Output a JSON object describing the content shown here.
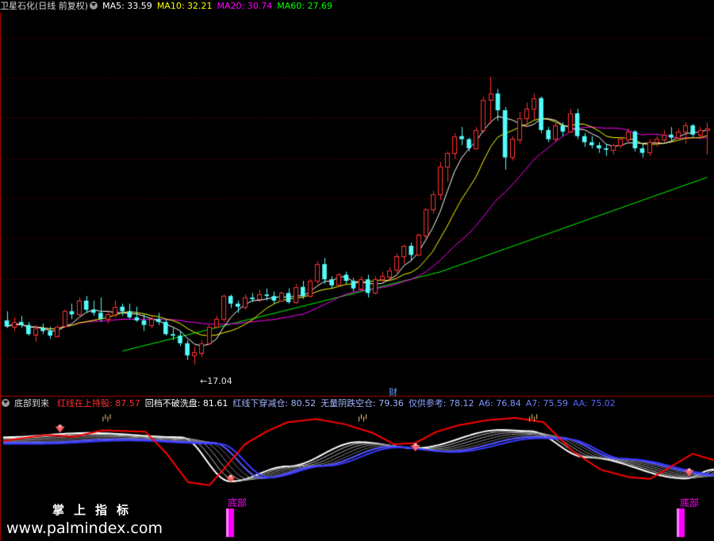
{
  "main_header": {
    "stock": "卫星石化(日线 前复权)",
    "ma5": "MA5: 33.59",
    "ma10": "MA10: 32.21",
    "ma20": "MA20: 30.74",
    "ma60": "MA60: 27.69"
  },
  "sub_header": {
    "name": "底部到来",
    "v1": "红线在上持股: 87.57",
    "v2": "回档不破洗盘: 81.61",
    "v3": "红线下穿减仓: 80.52",
    "v4": "无量阴跌空仓: 79.36",
    "v5": "仅供参考: 78.12",
    "a6": "A6: 76.84",
    "a7": "A7: 75.59",
    "aa": "AA: 75.02"
  },
  "annotations": {
    "low_price": "17.04",
    "cai": "财",
    "bottom1": "底部",
    "bottom2": "底部"
  },
  "watermark": {
    "title": "掌上指标",
    "url": "www.palmindex.com"
  },
  "colors": {
    "up": "#ff3232",
    "down": "#54fcfc",
    "ma5": "#ffffff",
    "ma10": "#ffff00",
    "ma20": "#ff00ff",
    "ma60": "#00ff00",
    "red_line": "#ff0000",
    "blue_line": "#3a3aff",
    "white_line": "#ffffff",
    "bottom_label": "#ff00ff",
    "axis": "#b00000"
  },
  "chart_data": [
    {
      "type": "candlestick",
      "title": "卫星石化(日线 前复权)",
      "ylim": [
        15.0,
        40.0
      ],
      "candles": [
        [
          19.9,
          20.5,
          19.4,
          19.5
        ],
        [
          19.5,
          20.1,
          19.2,
          19.8
        ],
        [
          19.8,
          20.2,
          19.4,
          19.6
        ],
        [
          19.6,
          19.8,
          18.9,
          19.0
        ],
        [
          19.0,
          19.6,
          18.5,
          19.4
        ],
        [
          19.4,
          19.7,
          19.0,
          19.2
        ],
        [
          19.2,
          19.5,
          18.7,
          18.9
        ],
        [
          18.9,
          19.6,
          18.8,
          19.5
        ],
        [
          19.5,
          20.6,
          19.4,
          20.5
        ],
        [
          20.5,
          21.0,
          20.0,
          20.3
        ],
        [
          20.3,
          21.4,
          20.1,
          21.2
        ],
        [
          21.2,
          21.5,
          20.4,
          20.6
        ],
        [
          20.6,
          21.2,
          20.2,
          20.4
        ],
        [
          20.4,
          21.4,
          19.8,
          20.0
        ],
        [
          20.0,
          20.5,
          19.7,
          20.3
        ],
        [
          20.3,
          21.2,
          20.1,
          20.8
        ],
        [
          20.8,
          21.0,
          20.2,
          20.5
        ],
        [
          20.5,
          21.0,
          20.0,
          20.1
        ],
        [
          20.1,
          20.8,
          19.8,
          19.9
        ],
        [
          19.9,
          20.3,
          19.2,
          19.6
        ],
        [
          19.6,
          20.2,
          19.4,
          20.0
        ],
        [
          20.0,
          20.4,
          19.6,
          19.8
        ],
        [
          19.8,
          20.0,
          18.9,
          19.0
        ],
        [
          19.0,
          19.4,
          18.6,
          18.9
        ],
        [
          18.9,
          19.2,
          18.2,
          18.4
        ],
        [
          18.4,
          18.6,
          17.3,
          17.6
        ],
        [
          17.6,
          18.2,
          17.0,
          17.8
        ],
        [
          17.8,
          18.6,
          17.5,
          18.4
        ],
        [
          18.4,
          19.6,
          18.3,
          19.5
        ],
        [
          19.5,
          20.2,
          19.4,
          20.0
        ],
        [
          20.0,
          21.6,
          19.8,
          21.5
        ],
        [
          21.5,
          21.6,
          20.7,
          21.0
        ],
        [
          21.0,
          21.2,
          20.4,
          20.8
        ],
        [
          20.8,
          21.6,
          20.6,
          21.4
        ],
        [
          21.4,
          21.7,
          21.1,
          21.3
        ],
        [
          21.3,
          21.9,
          21.1,
          21.6
        ],
        [
          21.6,
          22.0,
          21.2,
          21.5
        ],
        [
          21.5,
          21.8,
          21.0,
          21.2
        ],
        [
          21.2,
          21.8,
          21.1,
          21.7
        ],
        [
          21.7,
          22.0,
          21.0,
          21.1
        ],
        [
          21.1,
          22.3,
          21.0,
          22.1
        ],
        [
          22.1,
          22.5,
          21.3,
          21.5
        ],
        [
          21.5,
          22.6,
          21.4,
          22.5
        ],
        [
          22.5,
          23.8,
          22.3,
          23.6
        ],
        [
          23.6,
          24.0,
          22.3,
          22.6
        ],
        [
          22.6,
          22.8,
          22.0,
          22.2
        ],
        [
          22.2,
          23.0,
          22.1,
          22.9
        ],
        [
          22.9,
          23.1,
          22.3,
          22.5
        ],
        [
          22.5,
          22.7,
          21.8,
          22.0
        ],
        [
          22.0,
          22.8,
          21.8,
          22.6
        ],
        [
          22.6,
          22.9,
          21.4,
          21.7
        ],
        [
          21.7,
          22.8,
          21.6,
          22.6
        ],
        [
          22.6,
          23.1,
          22.4,
          22.8
        ],
        [
          22.8,
          23.4,
          22.5,
          23.2
        ],
        [
          23.2,
          24.3,
          23.0,
          24.1
        ],
        [
          24.1,
          24.9,
          23.6,
          24.8
        ],
        [
          24.8,
          25.0,
          23.8,
          24.2
        ],
        [
          24.2,
          25.6,
          24.1,
          25.5
        ],
        [
          25.5,
          27.3,
          25.3,
          27.2
        ],
        [
          27.2,
          28.4,
          26.9,
          28.2
        ],
        [
          28.2,
          30.3,
          27.8,
          30.0
        ],
        [
          30.0,
          31.0,
          29.0,
          30.9
        ],
        [
          30.9,
          32.2,
          30.5,
          32.0
        ],
        [
          32.0,
          32.6,
          31.4,
          31.8
        ],
        [
          31.8,
          31.9,
          31.0,
          31.2
        ],
        [
          31.2,
          32.6,
          31.1,
          32.4
        ],
        [
          32.4,
          34.6,
          32.2,
          34.4
        ],
        [
          34.4,
          35.9,
          32.8,
          34.8
        ],
        [
          34.8,
          35.1,
          33.0,
          33.7
        ],
        [
          33.7,
          33.9,
          29.8,
          30.6
        ],
        [
          30.6,
          32.0,
          30.4,
          31.8
        ],
        [
          31.8,
          33.6,
          31.5,
          33.2
        ],
        [
          33.2,
          34.2,
          32.6,
          33.8
        ],
        [
          33.8,
          34.8,
          33.1,
          34.5
        ],
        [
          34.5,
          34.6,
          32.2,
          32.4
        ],
        [
          32.4,
          32.6,
          31.6,
          31.8
        ],
        [
          31.8,
          32.9,
          31.6,
          32.7
        ],
        [
          32.7,
          32.9,
          32.0,
          32.3
        ],
        [
          32.3,
          33.8,
          32.2,
          33.5
        ],
        [
          33.5,
          33.8,
          31.8,
          32.0
        ],
        [
          32.0,
          32.2,
          31.3,
          31.6
        ],
        [
          31.6,
          32.0,
          31.2,
          31.4
        ],
        [
          31.4,
          31.6,
          30.9,
          31.2
        ],
        [
          31.2,
          31.5,
          30.7,
          31.1
        ],
        [
          31.1,
          31.5,
          30.8,
          31.4
        ],
        [
          31.4,
          31.9,
          31.2,
          31.8
        ],
        [
          31.8,
          32.5,
          31.6,
          32.3
        ],
        [
          32.3,
          32.4,
          31.0,
          31.2
        ],
        [
          31.2,
          31.5,
          30.6,
          30.9
        ],
        [
          30.9,
          31.8,
          30.7,
          31.6
        ],
        [
          31.6,
          32.0,
          31.3,
          31.8
        ],
        [
          31.8,
          32.4,
          31.6,
          32.1
        ],
        [
          32.1,
          32.6,
          31.7,
          31.9
        ],
        [
          31.9,
          32.5,
          31.8,
          32.3
        ],
        [
          32.3,
          32.9,
          31.5,
          32.7
        ],
        [
          32.7,
          32.8,
          31.9,
          32.1
        ],
        [
          32.1,
          32.6,
          31.8,
          32.4
        ],
        [
          32.4,
          32.9,
          30.8,
          32.5
        ]
      ],
      "ma_names": [
        "MA5",
        "MA10",
        "MA20",
        "MA60"
      ],
      "ma_values": [
        33.59,
        32.21,
        30.74,
        27.69
      ],
      "low_marker": 17.04
    },
    {
      "type": "line",
      "title": "底部到来",
      "series": [
        {
          "name": "红线在上持股",
          "value": 87.57
        },
        {
          "name": "回档不破洗盘",
          "value": 81.61
        },
        {
          "name": "红线下穿减仓",
          "value": 80.52
        },
        {
          "name": "无量阴跌空仓",
          "value": 79.36
        },
        {
          "name": "仅供参考",
          "value": 78.12
        },
        {
          "name": "A6",
          "value": 76.84
        },
        {
          "name": "A7",
          "value": 75.59
        },
        {
          "name": "AA",
          "value": 75.02
        }
      ],
      "bottom_signals": [
        "底部",
        "底部"
      ]
    }
  ]
}
